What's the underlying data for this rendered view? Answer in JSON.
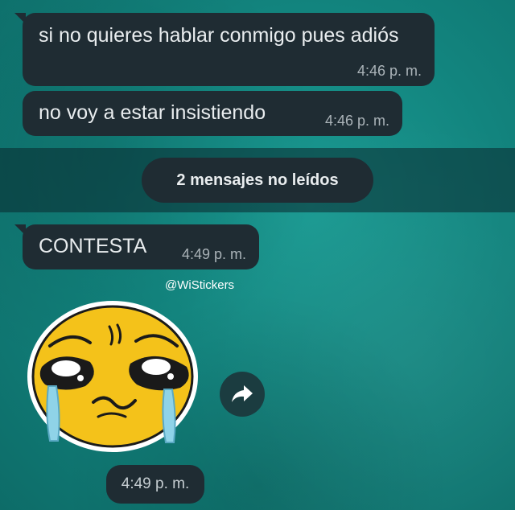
{
  "colors": {
    "wallpaper": "#12847e",
    "bubble": "#1f2c33",
    "text": "#e9edef",
    "timestamp": "#aab3b8"
  },
  "messages": [
    {
      "text": "si no quieres hablar conmigo pues adiós",
      "time": "4:46 p. m."
    },
    {
      "text": "no voy a estar insistiendo",
      "time": "4:46 p. m."
    },
    {
      "text": "CONTESTA",
      "time": "4:49 p. m."
    }
  ],
  "unread_banner": {
    "label": "2 mensajes no leídos"
  },
  "sticker": {
    "watermark": "@WiStickers",
    "icon": "crying-face-sticker",
    "time": "4:49 p. m."
  },
  "forward_button": {
    "icon": "forward-arrow-icon"
  }
}
